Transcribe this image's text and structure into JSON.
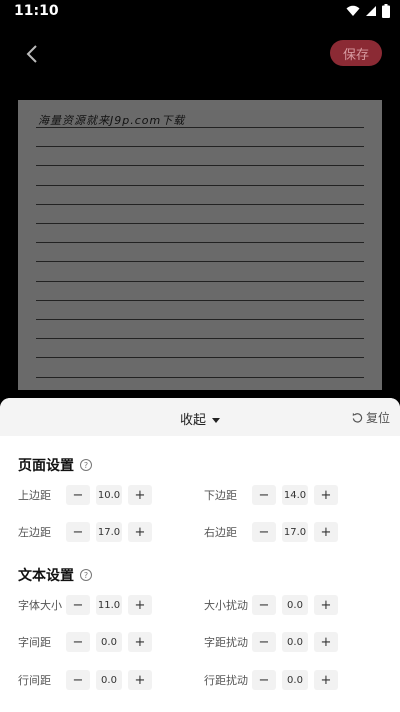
{
  "status": {
    "time": "11:10"
  },
  "header": {
    "save_label": "保存"
  },
  "paper": {
    "handwriting": "海量资源就来J9p.com下载"
  },
  "panel": {
    "collapse_label": "收起",
    "reset_label": "复位",
    "page_settings": {
      "title": "页面设置",
      "fields": [
        {
          "label": "上边距",
          "value": "10.0"
        },
        {
          "label": "下边距",
          "value": "14.0"
        },
        {
          "label": "左边距",
          "value": "17.0"
        },
        {
          "label": "右边距",
          "value": "17.0"
        }
      ]
    },
    "text_settings": {
      "title": "文本设置",
      "fields": [
        {
          "label": "字体大小",
          "value": "11.0"
        },
        {
          "label": "大小扰动",
          "value": "0.0"
        },
        {
          "label": "字间距",
          "value": "0.0"
        },
        {
          "label": "字距扰动",
          "value": "0.0"
        },
        {
          "label": "行间距",
          "value": "0.0"
        },
        {
          "label": "行距扰动",
          "value": "0.0"
        }
      ]
    },
    "minus_symbol": "−",
    "plus_symbol": "+"
  }
}
